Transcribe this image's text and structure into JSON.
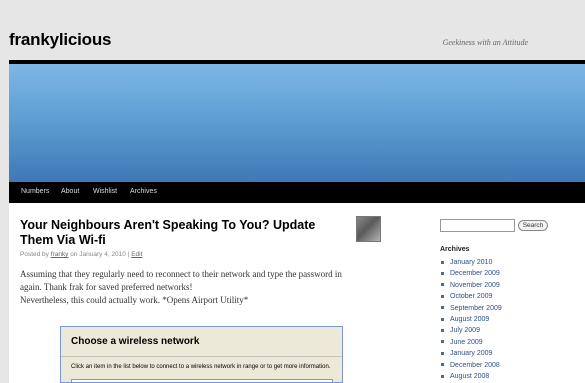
{
  "header": {
    "site_title": "frankylicious",
    "tagline": "Geekiness with an Attitude"
  },
  "nav": {
    "items": [
      "Numbers",
      "About",
      "Wishlist",
      "Archives"
    ]
  },
  "post": {
    "title": "Your Neighbours Aren't Speaking To You? Update Them Via Wi-fi",
    "meta_prefix": "Posted by",
    "author": "franky",
    "date_text": "on January 4, 2010 |",
    "edit_label": "Edit",
    "paragraph1": "Assuming that they regularly need to reconnect to their network and type the password in again. Thank frak for saved preferred networks!",
    "paragraph2": "Nevertheless, this could actually work. *Opens Airport Utility*"
  },
  "embedded_screenshot": {
    "title": "Choose a wireless network",
    "description": "Click an item in the list below to connect to a wireless network in range or to get more information."
  },
  "sidebar": {
    "search_button": "Search",
    "search_value": "",
    "archives_heading": "Archives",
    "archives": [
      "January 2010",
      "December 2009",
      "November 2009",
      "October 2009",
      "September 2009",
      "August 2009",
      "July 2009",
      "June 2009",
      "January 2009",
      "December 2008",
      "August 2008"
    ]
  },
  "colors": {
    "banner_top": "#7eb7e6",
    "banner_bottom": "#3f78b6",
    "nav_bg": "#000000",
    "link": "#2f4f8a"
  }
}
